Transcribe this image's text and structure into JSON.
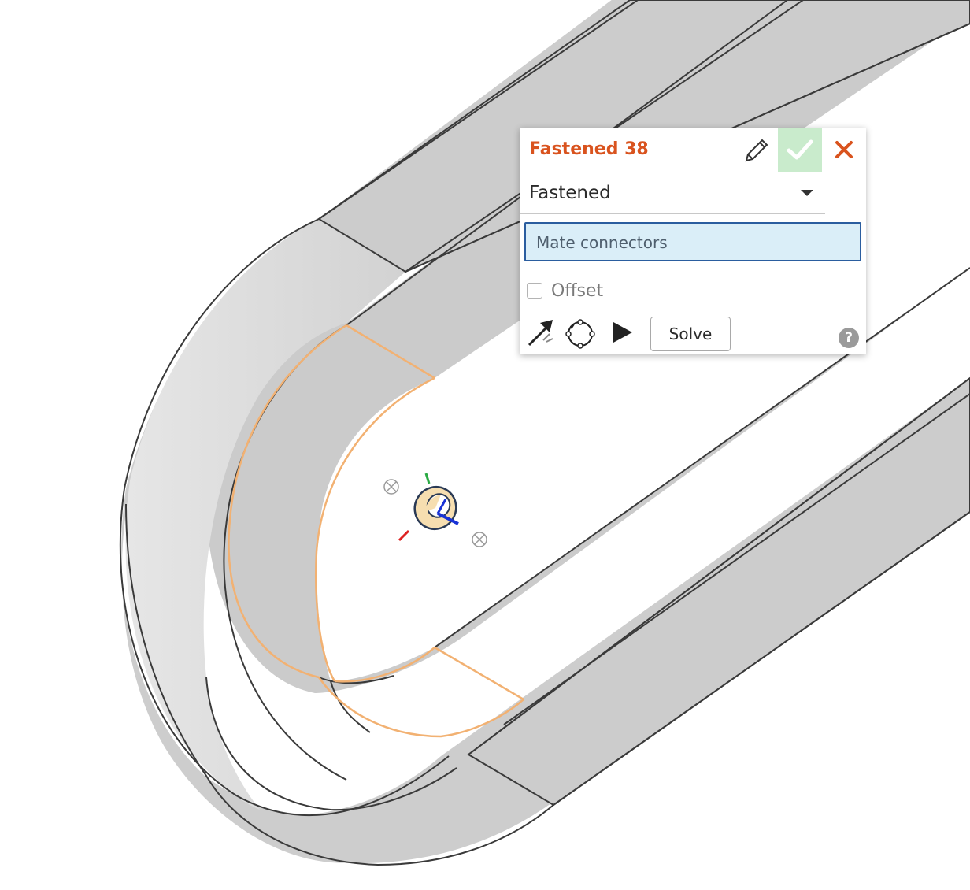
{
  "dialog": {
    "title": "Fastened 38",
    "title_color": "#d9531e",
    "edit_icon": "pencil-icon",
    "accept_icon": "checkmark-icon",
    "cancel_icon": "close-x-icon",
    "mate_type": {
      "selected": "Fastened"
    },
    "mate_connectors": {
      "label": "Mate connectors"
    },
    "offset": {
      "label": "Offset",
      "checked": false
    },
    "tools": {
      "flip_icon": "flip-primary-axis-icon",
      "reorient_icon": "reorient-secondary-axis-icon",
      "animate_icon": "play-animate-icon",
      "solve_label": "Solve",
      "help_label": "?"
    }
  },
  "viewport": {
    "part_face_color": "#cccccc",
    "selection_highlight_color": "#f2b172",
    "mate_connector_glyph": "mate-connector-icon"
  }
}
